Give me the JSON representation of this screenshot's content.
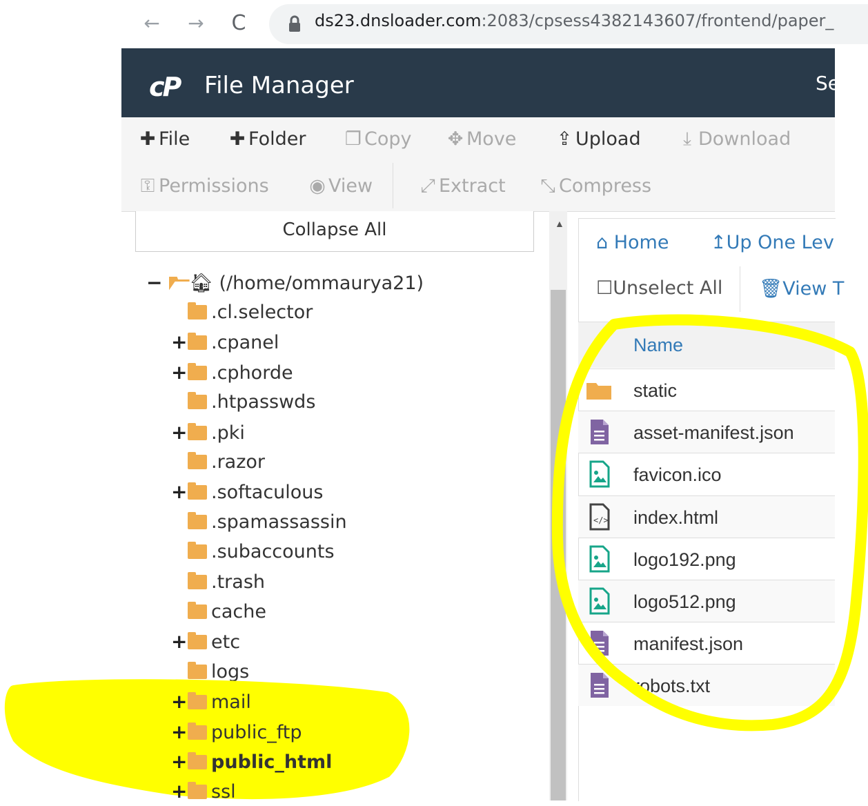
{
  "browser": {
    "url_host": "ds23.dnsloader.com",
    "url_rest": ":2083/cpsess4382143607/frontend/paper_"
  },
  "header": {
    "logo": "cP",
    "title": "File Manager",
    "search_partial": "Se"
  },
  "toolbar": {
    "row1": [
      {
        "label": "File",
        "icon": "plus-icon",
        "enabled": true
      },
      {
        "label": "Folder",
        "icon": "plus-icon",
        "enabled": true
      },
      {
        "label": "Copy",
        "icon": "copy-icon",
        "enabled": false
      },
      {
        "label": "Move",
        "icon": "move-icon",
        "enabled": false
      },
      {
        "label": "Upload",
        "icon": "upload-icon",
        "enabled": true
      },
      {
        "label": "Download",
        "icon": "download-icon",
        "enabled": false
      }
    ],
    "row2": [
      {
        "label": "Permissions",
        "icon": "key-icon",
        "enabled": false
      },
      {
        "label": "View",
        "icon": "eye-icon",
        "enabled": false
      },
      {
        "label": "Extract",
        "icon": "expand-icon",
        "enabled": false
      },
      {
        "label": "Compress",
        "icon": "compress-icon",
        "enabled": false
      }
    ]
  },
  "tree": {
    "collapse_label": "Collapse All",
    "root": "(/home/ommaurya21)",
    "items": [
      {
        "label": ".cl.selector",
        "expandable": false
      },
      {
        "label": ".cpanel",
        "expandable": true
      },
      {
        "label": ".cphorde",
        "expandable": true
      },
      {
        "label": ".htpasswds",
        "expandable": false
      },
      {
        "label": ".pki",
        "expandable": true
      },
      {
        "label": ".razor",
        "expandable": false
      },
      {
        "label": ".softaculous",
        "expandable": true
      },
      {
        "label": ".spamassassin",
        "expandable": false
      },
      {
        "label": ".subaccounts",
        "expandable": false
      },
      {
        "label": ".trash",
        "expandable": false
      },
      {
        "label": "cache",
        "expandable": false
      },
      {
        "label": "etc",
        "expandable": true
      },
      {
        "label": "logs",
        "expandable": false
      },
      {
        "label": "mail",
        "expandable": true
      },
      {
        "label": "public_ftp",
        "expandable": true
      },
      {
        "label": "public_html",
        "expandable": true,
        "bold": true
      },
      {
        "label": "ssl",
        "expandable": true
      }
    ]
  },
  "right": {
    "home_label": "Home",
    "up_label": "Up One Lev",
    "unselect_label": "Unselect All",
    "view_label": "View T",
    "name_header": "Name",
    "files": [
      {
        "name": "static",
        "type": "folder"
      },
      {
        "name": "asset-manifest.json",
        "type": "text"
      },
      {
        "name": "favicon.ico",
        "type": "image"
      },
      {
        "name": "index.html",
        "type": "code"
      },
      {
        "name": "logo192.png",
        "type": "image"
      },
      {
        "name": "logo512.png",
        "type": "image"
      },
      {
        "name": "manifest.json",
        "type": "text"
      },
      {
        "name": "robots.txt",
        "type": "text"
      }
    ]
  },
  "colors": {
    "header_bg": "#293a4a",
    "folder": "#f0ad4e",
    "link": "#337ab7",
    "highlight": "#ffff00",
    "text_file": "#8064a2",
    "image_file": "#17a589"
  }
}
